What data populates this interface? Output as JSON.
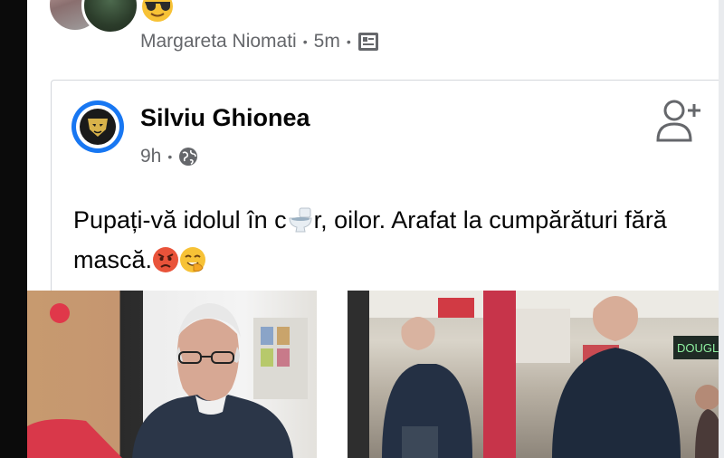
{
  "share": {
    "author": "Margareta Niomati",
    "time": "5m",
    "separator": "•",
    "emoji": "smiling-face-with-sunglasses",
    "audience_icon": "gallery-icon"
  },
  "post": {
    "author": "Silviu Ghionea",
    "time": "9h",
    "separator": "•",
    "audience_icon": "globe-icon",
    "text_part1": "Pupați-vă idolul în c",
    "inline_icon": "toilet-icon",
    "text_part2": "r, oilor. Arafat la cumpărături fără mască.",
    "text_emojis": [
      "angry-face",
      "smiling-face-with-hand-over-mouth"
    ],
    "follow_icon": "add-friend-icon"
  },
  "photos": {
    "count": 2,
    "sign_text": "DOUGLA"
  },
  "colors": {
    "meta_text": "#65676b",
    "page_logo_ring": "#1877f2",
    "card_border": "#d4d7dc"
  }
}
